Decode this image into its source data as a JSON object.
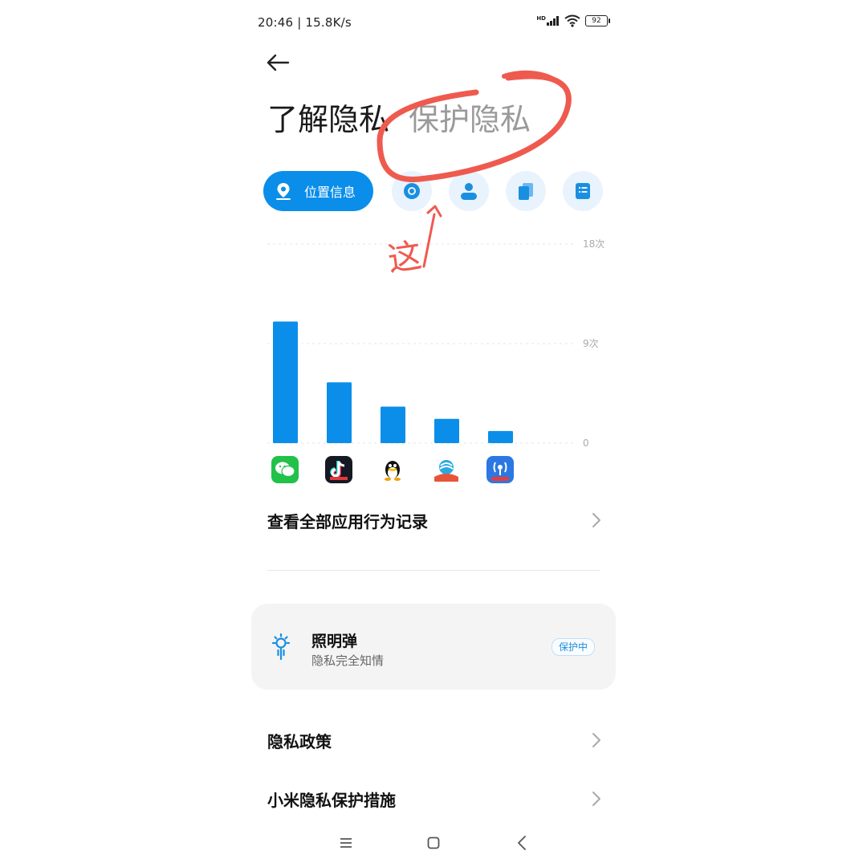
{
  "status_bar": {
    "time_speed": "20:46 | 15.8K/s",
    "hd": "HD",
    "battery": "92"
  },
  "header": {
    "tab_understand": "了解隐私",
    "tab_protect": "保护隐私"
  },
  "annotation": {
    "handwritten_text": "这"
  },
  "categories": {
    "location_label": "位置信息",
    "icons": [
      "location-pin-icon",
      "camera-icon",
      "contacts-icon",
      "files-icon",
      "document-icon"
    ]
  },
  "chart_data": {
    "type": "bar",
    "categories": [
      "微信",
      "抖音",
      "QQ",
      "中国移动",
      "WiFi万能钥匙"
    ],
    "values": [
      11,
      5.5,
      3.3,
      2.2,
      1.1
    ],
    "ylim": [
      0,
      18
    ],
    "ytick_labels": [
      "18次",
      "9次",
      "0"
    ],
    "bar_color": "#0b8eea"
  },
  "rows": {
    "view_all": "查看全部应用行为记录",
    "privacy_policy": "隐私政策",
    "mi_privacy": "小米隐私保护措施"
  },
  "flare_card": {
    "title": "照明弹",
    "subtitle": "隐私完全知情",
    "badge": "保护中"
  },
  "colors": {
    "accent": "#0b8eea",
    "annotation": "#ef5a4f"
  }
}
